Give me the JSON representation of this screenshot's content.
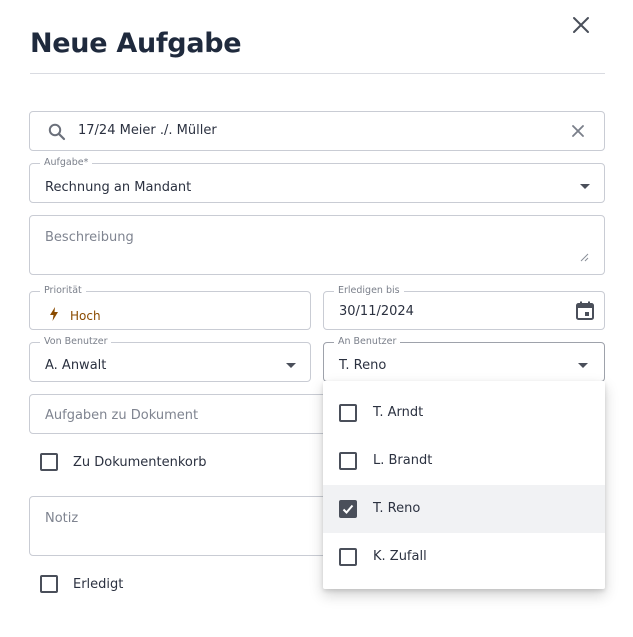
{
  "dialog": {
    "title": "Neue Aufgabe"
  },
  "search": {
    "value": "17/24 Meier ./. Müller"
  },
  "task": {
    "label": "Aufgabe*",
    "value": "Rechnung an Mandant"
  },
  "description": {
    "placeholder": "Beschreibung"
  },
  "priority": {
    "label": "Priorität",
    "value": "Hoch",
    "color": "#8a4b00"
  },
  "due": {
    "label": "Erledigen bis",
    "value": "30/11/2024"
  },
  "from_user": {
    "label": "Von Benutzer",
    "value": "A. Anwalt"
  },
  "to_user": {
    "label": "An Benutzer",
    "value": "T. Reno",
    "options": [
      {
        "label": "T. Arndt",
        "checked": false
      },
      {
        "label": "L. Brandt",
        "checked": false
      },
      {
        "label": "T. Reno",
        "checked": true
      },
      {
        "label": "K. Zufall",
        "checked": false
      }
    ]
  },
  "doc_tasks": {
    "placeholder": "Aufgaben zu Dokument"
  },
  "basket": {
    "label": "Zu Dokumentenkorb",
    "checked": false
  },
  "note": {
    "placeholder": "Notiz"
  },
  "done": {
    "label": "Erledigt",
    "checked": false
  },
  "colors": {
    "text": "#2b3140",
    "border": "#c9ccd4",
    "icon": "#4a4f5a",
    "priority": "#8a4b00"
  }
}
